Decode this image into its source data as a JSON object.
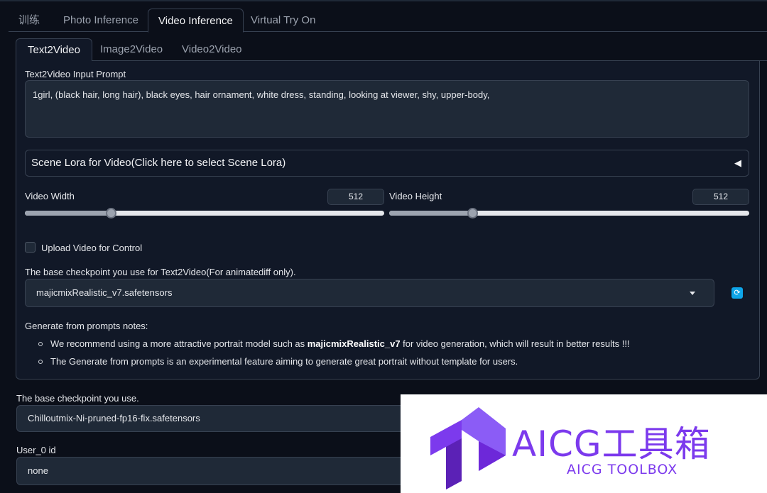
{
  "outer_tabs": [
    {
      "label": "训练"
    },
    {
      "label": "Photo Inference"
    },
    {
      "label": "Video Inference",
      "active": true
    },
    {
      "label": "Virtual Try On"
    }
  ],
  "inner_tabs": [
    {
      "label": "Text2Video",
      "active": true
    },
    {
      "label": "Image2Video"
    },
    {
      "label": "Video2Video"
    }
  ],
  "prompt": {
    "label": "Text2Video Input Prompt",
    "value": "1girl, (black hair, long hair), black eyes, hair ornament, white dress, standing, looking at viewer, shy, upper-body,"
  },
  "scene_lora": {
    "label": "Scene Lora for Video(Click here to select Scene Lora)",
    "arrow": "◀"
  },
  "video_width": {
    "label": "Video Width",
    "value": "512",
    "fraction": 0.24
  },
  "video_height": {
    "label": "Video Height",
    "value": "512",
    "fraction": 0.23
  },
  "upload_control": {
    "label": "Upload Video for Control",
    "checked": false
  },
  "base_checkpoint_t2v": {
    "label": "The base checkpoint you use for Text2Video(For animatediff only).",
    "value": "majicmixRealistic_v7.safetensors"
  },
  "refresh_icon": "refresh-icon",
  "notes": {
    "title": "Generate from prompts notes:",
    "item1_pre": "We recommend using a more attractive portrait model such as ",
    "item1_bold": "majicmixRealistic_v7",
    "item1_post": " for video generation, which will result in better results !!!",
    "item2": "The Generate from prompts is an experimental feature aiming to generate great portrait without template for users."
  },
  "base_checkpoint": {
    "label": "The base checkpoint you use.",
    "value": "Chilloutmix-Ni-pruned-fp16-fix.safetensors"
  },
  "user_id": {
    "label": "User_0 id",
    "value": "none"
  },
  "watermark": {
    "title": "AICG工具箱",
    "subtitle": "AICG TOOLBOX",
    "color": "#7c3aed"
  }
}
